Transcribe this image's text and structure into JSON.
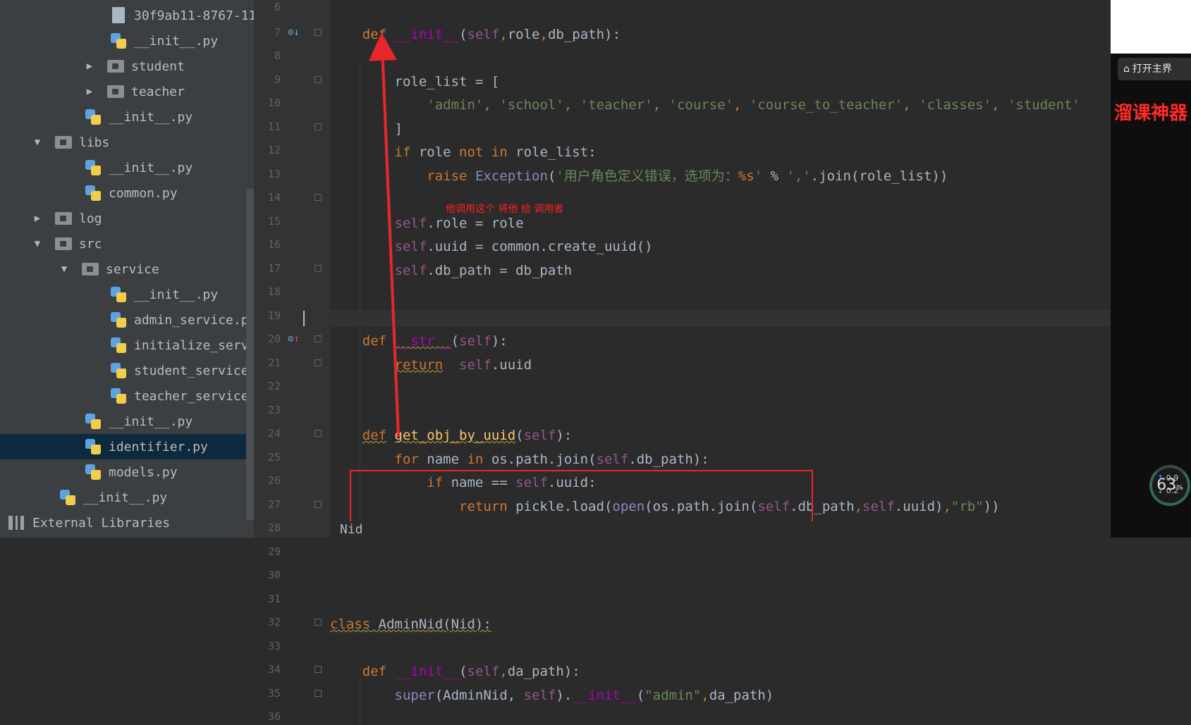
{
  "project_tree": {
    "items": [
      {
        "label": "30f9ab11-8767-11",
        "type": "file",
        "indent": 4,
        "arrow": ""
      },
      {
        "label": "__init__.py",
        "type": "py",
        "indent": 4,
        "arrow": ""
      },
      {
        "label": "student",
        "type": "folder",
        "indent": 3,
        "arrow": "▶"
      },
      {
        "label": "teacher",
        "type": "folder",
        "indent": 3,
        "arrow": "▶"
      },
      {
        "label": "__init__.py",
        "type": "py",
        "indent": 3,
        "arrow": ""
      },
      {
        "label": "libs",
        "type": "folder",
        "indent": 1,
        "arrow": "▼"
      },
      {
        "label": "__init__.py",
        "type": "py",
        "indent": 3,
        "arrow": ""
      },
      {
        "label": "common.py",
        "type": "py",
        "indent": 3,
        "arrow": ""
      },
      {
        "label": "log",
        "type": "folder",
        "indent": 1,
        "arrow": "▶"
      },
      {
        "label": "src",
        "type": "folder",
        "indent": 1,
        "arrow": "▼"
      },
      {
        "label": "service",
        "type": "folder",
        "indent": 2,
        "arrow": "▼"
      },
      {
        "label": "__init__.py",
        "type": "py",
        "indent": 4,
        "arrow": ""
      },
      {
        "label": "admin_service.py",
        "type": "py",
        "indent": 4,
        "arrow": ""
      },
      {
        "label": "initialize_servi",
        "type": "py",
        "indent": 4,
        "arrow": ""
      },
      {
        "label": "student_service.",
        "type": "py",
        "indent": 4,
        "arrow": ""
      },
      {
        "label": "teacher_service.",
        "type": "py",
        "indent": 4,
        "arrow": ""
      },
      {
        "label": "__init__.py",
        "type": "py",
        "indent": 3,
        "arrow": ""
      },
      {
        "label": "identifier.py",
        "type": "py",
        "indent": 3,
        "arrow": "",
        "selected": true
      },
      {
        "label": "models.py",
        "type": "py",
        "indent": 3,
        "arrow": ""
      },
      {
        "label": "__init__.py",
        "type": "py",
        "indent": 2,
        "arrow": ""
      },
      {
        "label": "External Libraries",
        "type": "lib",
        "indent": 0,
        "arrow": ""
      }
    ]
  },
  "editor": {
    "line_numbers": [
      "6",
      "7",
      "8",
      "9",
      "10",
      "11",
      "12",
      "13",
      "14",
      "15",
      "16",
      "17",
      "18",
      "19",
      "20",
      "21",
      "22",
      "23",
      "24",
      "25",
      "26",
      "27",
      "28",
      "29",
      "30",
      "31",
      "32",
      "33",
      "34",
      "35",
      "36"
    ],
    "lines": [
      [],
      [
        [
          "    ",
          ""
        ],
        [
          "def",
          "kw"
        ],
        [
          " ",
          ""
        ],
        [
          "__init__",
          "mg"
        ],
        [
          "(",
          ""
        ],
        [
          "self",
          "slf"
        ],
        [
          ",",
          "kw"
        ],
        [
          "role",
          ""
        ],
        [
          ",",
          "kw"
        ],
        [
          "db_path):",
          ""
        ]
      ],
      [],
      [
        [
          "        role_list = [",
          ""
        ]
      ],
      [
        [
          "            ",
          ""
        ],
        [
          "'admin'",
          "str"
        ],
        [
          ", ",
          "kw"
        ],
        [
          "'school'",
          "str"
        ],
        [
          ", ",
          "kw"
        ],
        [
          "'teacher'",
          "str"
        ],
        [
          ", ",
          "kw"
        ],
        [
          "'course'",
          "str"
        ],
        [
          ", ",
          "kw"
        ],
        [
          "'course_to_teacher'",
          "str"
        ],
        [
          ", ",
          "kw"
        ],
        [
          "'classes'",
          "str"
        ],
        [
          ", ",
          "kw"
        ],
        [
          "'student'",
          "str"
        ]
      ],
      [
        [
          "        ]",
          ""
        ]
      ],
      [
        [
          "        ",
          ""
        ],
        [
          "if",
          "kw"
        ],
        [
          " role ",
          ""
        ],
        [
          "not in",
          "kw"
        ],
        [
          " role_list:",
          ""
        ]
      ],
      [
        [
          "            ",
          ""
        ],
        [
          "raise",
          "kw"
        ],
        [
          " ",
          ""
        ],
        [
          "Exception",
          "bi"
        ],
        [
          "(",
          ""
        ],
        [
          "'用户角色定义错误，选项为：",
          "str"
        ],
        [
          "%s",
          "pct"
        ],
        [
          "'",
          "str"
        ],
        [
          " % ",
          ""
        ],
        [
          "','",
          "str"
        ],
        [
          ".join(role_list))",
          ""
        ]
      ],
      [],
      [
        [
          "        ",
          ""
        ],
        [
          "self",
          "slf"
        ],
        [
          ".role = role",
          ""
        ]
      ],
      [
        [
          "        ",
          ""
        ],
        [
          "self",
          "slf"
        ],
        [
          ".uuid = common.create_uuid()",
          ""
        ]
      ],
      [
        [
          "        ",
          ""
        ],
        [
          "self",
          "slf"
        ],
        [
          ".db_path = db_path",
          ""
        ]
      ],
      [],
      [],
      [
        [
          "    ",
          ""
        ],
        [
          "def",
          "kw"
        ],
        [
          " ",
          ""
        ],
        [
          "__str__",
          "mg"
        ],
        [
          "(",
          ""
        ],
        [
          "self",
          "slf"
        ],
        [
          "):",
          ""
        ]
      ],
      [
        [
          "        ",
          ""
        ],
        [
          "return",
          "kw"
        ],
        [
          "  ",
          ""
        ],
        [
          "self",
          "slf"
        ],
        [
          ".uuid",
          ""
        ]
      ],
      [],
      [],
      [
        [
          "    ",
          ""
        ],
        [
          "def",
          "kw"
        ],
        [
          " ",
          ""
        ],
        [
          "get_obj_by_uuid",
          "fn"
        ],
        [
          "(",
          ""
        ],
        [
          "self",
          "slf"
        ],
        [
          "):",
          ""
        ]
      ],
      [
        [
          "        ",
          ""
        ],
        [
          "for",
          "kw"
        ],
        [
          " name ",
          ""
        ],
        [
          "in",
          "kw"
        ],
        [
          " os.path.join(",
          ""
        ],
        [
          "self",
          "slf"
        ],
        [
          ".db_path):",
          ""
        ]
      ],
      [
        [
          "            ",
          ""
        ],
        [
          "if",
          "kw"
        ],
        [
          " name == ",
          ""
        ],
        [
          "self",
          "slf"
        ],
        [
          ".uuid:",
          ""
        ]
      ],
      [
        [
          "                ",
          ""
        ],
        [
          "return",
          "kw"
        ],
        [
          " pickle.load(",
          ""
        ],
        [
          "open",
          "bi"
        ],
        [
          "(os.path.join(",
          ""
        ],
        [
          "self",
          "slf"
        ],
        [
          ".db_path",
          ""
        ],
        [
          ",",
          "kw"
        ],
        [
          "self",
          "slf"
        ],
        [
          ".uuid)",
          ""
        ],
        [
          ",",
          "kw"
        ],
        [
          "\"rb\"",
          "str"
        ],
        [
          "))",
          ""
        ]
      ],
      [],
      [],
      [],
      [],
      [
        [
          "",
          ""
        ],
        [
          "class",
          "kw"
        ],
        [
          " AdminNid(Nid):",
          ""
        ]
      ],
      [],
      [
        [
          "    ",
          ""
        ],
        [
          "def",
          "kw"
        ],
        [
          " ",
          ""
        ],
        [
          "__init__",
          "mg"
        ],
        [
          "(",
          ""
        ],
        [
          "self",
          "slf"
        ],
        [
          ",",
          "kw"
        ],
        [
          "da_path):",
          ""
        ]
      ],
      [
        [
          "        ",
          ""
        ],
        [
          "super",
          "bi"
        ],
        [
          "(AdminNid, ",
          ""
        ],
        [
          "self",
          "slf"
        ],
        [
          ").",
          ""
        ],
        [
          "__init__",
          "mg"
        ],
        [
          "(",
          ""
        ],
        [
          "\"admin\"",
          "str"
        ],
        [
          ",",
          "kw"
        ],
        [
          "da_path)",
          ""
        ]
      ],
      []
    ]
  },
  "annotation": {
    "text": "他调用这个 将他 给 调用者",
    "color": "#ff2020"
  },
  "status_bar": {
    "context": "Nid"
  },
  "overlay": {
    "open_button": "打开主界",
    "brand_text": "溜课神器",
    "gauge_value": "63",
    "gauge_unit": "%",
    "net_up": "0.9",
    "net_down": "0.2"
  },
  "colors": {
    "keyword": "#cc7832",
    "string": "#6a8759",
    "self": "#94558d",
    "magic": "#b200b2",
    "annotation_red": "#e8272c"
  }
}
